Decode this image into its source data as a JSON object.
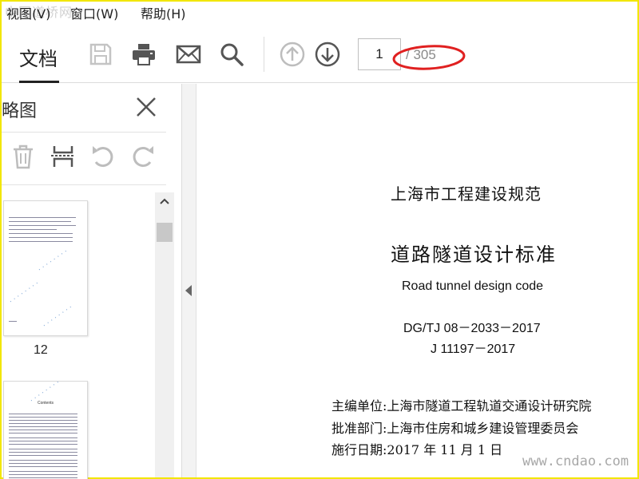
{
  "watermark_top": "中国道桥网",
  "watermark_bottom": "www.cndao.com",
  "menu": {
    "items": [
      {
        "label": "视图(V)"
      },
      {
        "label": "窗口(W)"
      },
      {
        "label": "帮助(H)"
      }
    ]
  },
  "toolbar": {
    "tab_label": "文档",
    "icons": [
      "save-icon",
      "print-icon",
      "mail-icon",
      "search-icon",
      "page-up-icon",
      "page-down-icon"
    ],
    "page_current": "1",
    "page_total": "/ 305",
    "highlight_color": "#e02020"
  },
  "sidebar": {
    "title": "略图",
    "tools": [
      "delete-icon",
      "extract-icon",
      "rotate-left-icon",
      "rotate-right-icon"
    ],
    "thumb_label": "12",
    "thumb2_title": "Contents"
  },
  "document": {
    "org": "上海市工程建设规范",
    "title": "道路隧道设计标准",
    "english_title": "Road tunnel design code",
    "code1": "DG/TJ 08－2033－2017",
    "code2": "J 11197－2017",
    "meta": [
      "主编单位:上海市隧道工程轨道交通设计研究院",
      "批准部门:上海市住房和城乡建设管理委员会",
      "施行日期:2017 年 11 月 1 日"
    ]
  }
}
